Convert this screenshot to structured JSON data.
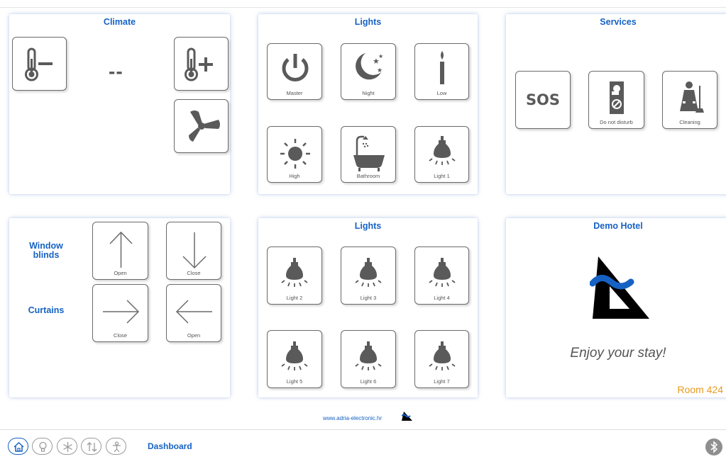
{
  "panels": {
    "climate": {
      "title": "Climate",
      "temperature": "--",
      "buttons": {
        "temp_down": "thermometer-minus",
        "temp_up": "thermometer-plus",
        "fan": "fan"
      }
    },
    "lights_top": {
      "title": "Lights",
      "buttons": [
        {
          "label": "Master",
          "icon": "power-icon"
        },
        {
          "label": "Night",
          "icon": "moon-stars-icon"
        },
        {
          "label": "Low",
          "icon": "candle-icon"
        },
        {
          "label": "High",
          "icon": "sun-icon"
        },
        {
          "label": "Bathroom",
          "icon": "bathtub-icon"
        },
        {
          "label": "Light 1",
          "icon": "bulb-icon"
        }
      ]
    },
    "services": {
      "title": "Services",
      "buttons": [
        {
          "label": "",
          "text": "SOS",
          "icon": "sos-icon"
        },
        {
          "label": "Do not disturb",
          "icon": "door-hanger-icon"
        },
        {
          "label": "Cleaning",
          "icon": "maid-icon"
        }
      ]
    },
    "blinds": {
      "window_blinds_label": "Window blinds",
      "curtains_label": "Curtains",
      "buttons": {
        "blinds_open": "Open",
        "blinds_close": "Close",
        "curtains_close": "Close",
        "curtains_open": "Open"
      }
    },
    "lights_bottom": {
      "title": "Lights",
      "buttons": [
        {
          "label": "Light 2"
        },
        {
          "label": "Light 3"
        },
        {
          "label": "Light 4"
        },
        {
          "label": "Light 5"
        },
        {
          "label": "Light 6"
        },
        {
          "label": "Light 7"
        }
      ]
    },
    "hotel": {
      "title": "Demo Hotel",
      "message": "Enjoy your stay!",
      "room": "Room 424"
    }
  },
  "footer": {
    "url": "www.adria-electronic.hr"
  },
  "nav": {
    "items": [
      "home-icon",
      "bulb-icon",
      "snowflake-icon",
      "updown-arrows-icon",
      "person-icon"
    ],
    "active": "Dashboard"
  },
  "colors": {
    "accent": "#1662c4",
    "room": "#e89a1e",
    "icon": "#5a5a5a"
  }
}
